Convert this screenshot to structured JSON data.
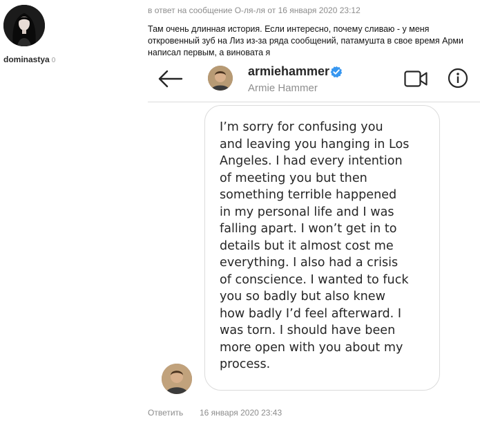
{
  "comment": {
    "author": {
      "name": "dominastya",
      "count": "0",
      "avatar": "avatar-photo"
    },
    "reply_meta": "в ответ на сообщение О-ля-ля от 16 января 2020 23:12",
    "text": "Там очень длинная история. Если интересно, почему сливаю - у меня откровенный зуб на Лиз из-за ряда сообщений, патамушта в свое время Арми написал первым, а виновата я",
    "reply_label": "Ответить",
    "timestamp": "16 января 2020 23:43"
  },
  "screenshot": {
    "header": {
      "username": "armiehammer",
      "full_name": "Armie Hammer",
      "icons": [
        "back-arrow-icon",
        "verified-badge-icon",
        "video-call-icon",
        "info-icon"
      ]
    },
    "message": "I’m sorry for confusing you\nand leaving you hanging in Los\nAngeles. I had every intention\nof meeting you but then\nsomething terrible happened\nin my personal life and I was\nfalling apart. I won’t get in to\ndetails but it almost cost me\neverything. I also had a crisis\nof conscience. I wanted to fuck\nyou so badly but also knew\nhow badly I’d feel afterward. I\nwas torn. I should have been\nmore open with you about my\nprocess.",
    "colors": {
      "verified": "#3897f0",
      "text": "#262626",
      "secondary": "#8e8e8e",
      "border": "#dbdbdb"
    }
  }
}
